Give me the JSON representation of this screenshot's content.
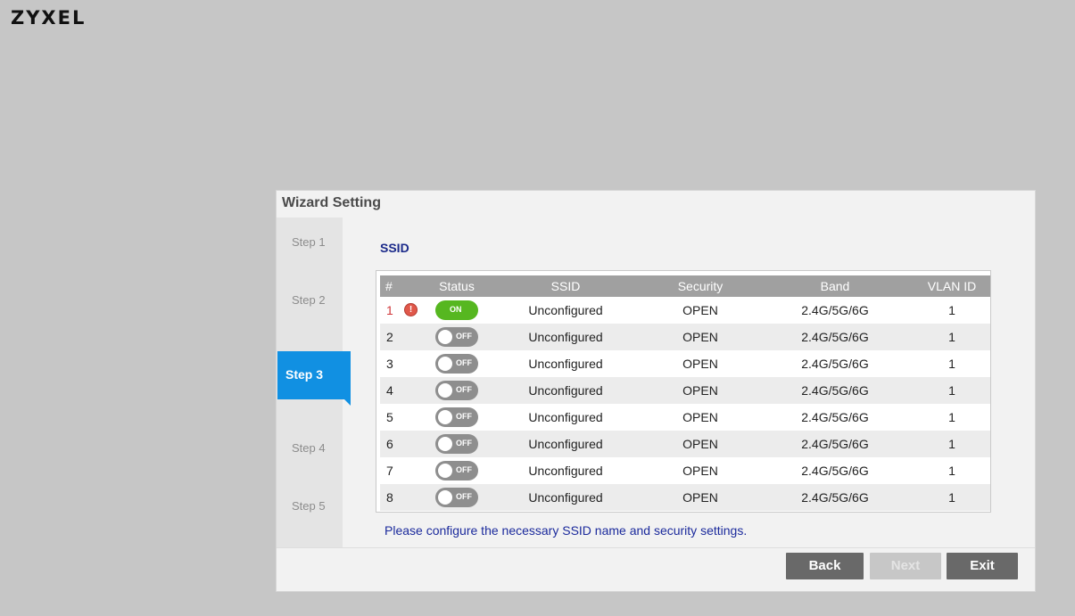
{
  "brand": {
    "logo_text": "ZYXEL"
  },
  "wizard": {
    "title": "Wizard Setting",
    "steps": [
      "Step 1",
      "Step 2",
      "Step 3",
      "Step 4",
      "Step 5"
    ],
    "active_step": "Step 3",
    "section_title": "SSID",
    "table": {
      "headers": [
        "#",
        "Status",
        "SSID",
        "Security",
        "Band",
        "VLAN ID"
      ],
      "rows": [
        {
          "num": "1",
          "warning": true,
          "status": "ON",
          "ssid": "Unconfigured",
          "security": "OPEN",
          "band": "2.4G/5G/6G",
          "vlan": "1"
        },
        {
          "num": "2",
          "status": "OFF",
          "ssid": "Unconfigured",
          "security": "OPEN",
          "band": "2.4G/5G/6G",
          "vlan": "1"
        },
        {
          "num": "3",
          "status": "OFF",
          "ssid": "Unconfigured",
          "security": "OPEN",
          "band": "2.4G/5G/6G",
          "vlan": "1"
        },
        {
          "num": "4",
          "status": "OFF",
          "ssid": "Unconfigured",
          "security": "OPEN",
          "band": "2.4G/5G/6G",
          "vlan": "1"
        },
        {
          "num": "5",
          "status": "OFF",
          "ssid": "Unconfigured",
          "security": "OPEN",
          "band": "2.4G/5G/6G",
          "vlan": "1"
        },
        {
          "num": "6",
          "status": "OFF",
          "ssid": "Unconfigured",
          "security": "OPEN",
          "band": "2.4G/5G/6G",
          "vlan": "1"
        },
        {
          "num": "7",
          "status": "OFF",
          "ssid": "Unconfigured",
          "security": "OPEN",
          "band": "2.4G/5G/6G",
          "vlan": "1"
        },
        {
          "num": "8",
          "status": "OFF",
          "ssid": "Unconfigured",
          "security": "OPEN",
          "band": "2.4G/5G/6G",
          "vlan": "1"
        }
      ]
    },
    "note": "Please configure the necessary SSID name and security settings.",
    "buttons": {
      "back": "Back",
      "next": "Next",
      "exit": "Exit"
    }
  },
  "colors": {
    "accent": "#1190e2",
    "toggle_on": "#56b720",
    "toggle_off": "#8e8e8e",
    "warning": "#d0373a",
    "note_text": "#1b2a9c"
  }
}
